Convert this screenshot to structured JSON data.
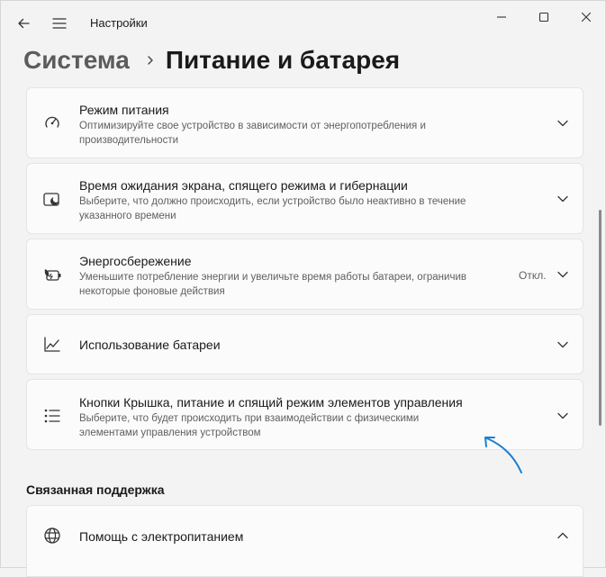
{
  "window": {
    "app_title": "Настройки",
    "controls": {
      "minimize_icon": "minimize-icon",
      "maximize_icon": "maximize-icon",
      "close_icon": "close-icon"
    }
  },
  "breadcrumb": {
    "parent": "Система",
    "current": "Питание и батарея"
  },
  "cards": [
    {
      "title": "Режим питания",
      "description": "Оптимизируйте свое устройство в зависимости от энергопотребления и производительности",
      "icon": "power-mode-icon",
      "expanded": false
    },
    {
      "title": "Время ожидания экрана, спящего режима и гибернации",
      "description": "Выберите, что должно происходить, если устройство было неактивно в течение указанного времени",
      "icon": "screen-sleep-icon",
      "expanded": false
    },
    {
      "title": "Энергосбережение",
      "description": "Уменьшите потребление энергии и увеличьте время работы батареи, ограничив некоторые фоновые действия",
      "icon": "energy-saver-icon",
      "status": "Откл.",
      "expanded": false
    },
    {
      "title": "Использование батареи",
      "icon": "battery-usage-icon",
      "expanded": false
    },
    {
      "title": "Кнопки Крышка, питание и спящий режим элементов управления",
      "description": "Выберите, что будет происходить при взаимодействии с физическими элементами управления устройством",
      "icon": "lid-buttons-icon",
      "expanded": false
    }
  ],
  "related": {
    "header": "Связанная поддержка",
    "items": [
      {
        "title": "Помощь с электропитанием",
        "icon": "globe-icon",
        "expanded": true
      }
    ]
  },
  "colors": {
    "accent": "#1e6fd1",
    "annotation_arrow": "#1a7fd4"
  }
}
